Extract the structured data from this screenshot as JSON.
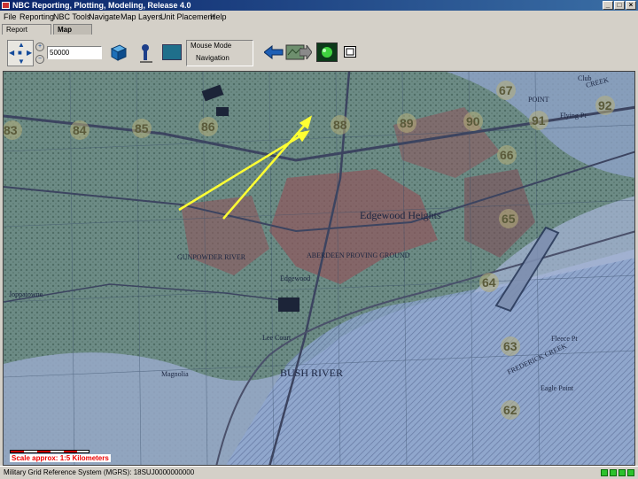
{
  "window": {
    "title": "NBC Reporting, Plotting, Modeling, Release 4.0"
  },
  "menu": [
    "File",
    "Reporting",
    "NBC Tools",
    "Navigate",
    "Map Layers",
    "Unit Placement",
    "Help"
  ],
  "tabs": [
    "Report Center",
    "Map View"
  ],
  "toolbar": {
    "scale_value": "50000",
    "mouse_mode_label": "Mouse Mode",
    "mouse_mode_value": "Navigation"
  },
  "map": {
    "grid_labels": [
      "83",
      "84",
      "85",
      "86",
      "88",
      "89",
      "90",
      "91",
      "92",
      "67",
      "66",
      "65",
      "64",
      "63",
      "62"
    ],
    "place_names": [
      "Edgewood Heights",
      "Joppatowne",
      "Edgewood",
      "ABERDEEN PROVING GROUND",
      "Magnolia",
      "Fleece Pt",
      "BUSH RIVER",
      "GUNPOWDER RIVER",
      "Lee Court",
      "Eagle Point",
      "Club",
      "POINT",
      "FREDERICK CREEK",
      "Flying Pt",
      "CREEK"
    ],
    "scale_text": "Scale approx: 1:5 Kilometers"
  },
  "status": {
    "text": "Military Grid Reference System (MGRS): 18SUJ0000000000"
  },
  "colors": {
    "title_bar": "#0a246a",
    "annotation": "#ffff33",
    "urban": "#8c5a5f",
    "water": "#8fa7d1"
  }
}
